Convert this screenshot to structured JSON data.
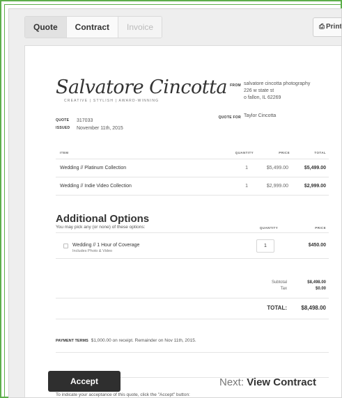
{
  "tabs": [
    {
      "label": "Quote",
      "state": "active"
    },
    {
      "label": "Contract",
      "state": "enabled"
    },
    {
      "label": "Invoice",
      "state": "disabled"
    }
  ],
  "print_label": "Print",
  "icons": {
    "print": "printer-icon",
    "checkbox": "checkbox-icon"
  },
  "logo": {
    "name": "Salvatore Cincotta",
    "tagline": "CREATIVE | STYLISH | AWARD-WINNING"
  },
  "from": {
    "label": "FROM",
    "lines": [
      "salvatore cincotta photography",
      "226 w state st",
      "o fallon, IL 62269"
    ]
  },
  "quote_for": {
    "label": "QUOTE FOR",
    "value": "Taylor Cincotta"
  },
  "meta": {
    "quote_label": "QUOTE",
    "quote_value": "317033",
    "issued_label": "ISSUED",
    "issued_value": "November 11th, 2015"
  },
  "items_header": {
    "item": "ITEM",
    "quantity": "QUANTITY",
    "price": "PRICE",
    "total": "TOTAL"
  },
  "items": [
    {
      "name": "Wedding // Platinum Collection",
      "quantity": "1",
      "price": "$5,499.00",
      "total": "$5,499.00"
    },
    {
      "name": "Wedding // Indie Video Collection",
      "quantity": "1",
      "price": "$2,999.00",
      "total": "$2,999.00"
    }
  ],
  "additional": {
    "title": "Additional Options",
    "subtitle": "You may pick any (or none) of these options:",
    "quantity_header": "QUANTITY",
    "price_header": "PRICE",
    "options": [
      {
        "name": "Wedding // 1 Hour of Coverage",
        "desc": "Includes Photo & Video",
        "quantity": "1",
        "price": "$450.00",
        "checked": false
      }
    ]
  },
  "summary": {
    "subtotal_label": "Subtotal",
    "subtotal_value": "$8,498.00",
    "tax_label": "Tax",
    "tax_value": "$0.00",
    "total_label": "TOTAL:",
    "total_value": "$8,498.00"
  },
  "payment_terms": {
    "label": "PAYMENT TERMS",
    "text": "$1,000.00 on receipt. Remainder on Nov 11th, 2015."
  },
  "acceptance_note": "To indicate your acceptance of this quote, click the \"Accept\" button:",
  "accept_label": "Accept",
  "next": {
    "prefix": "Next:",
    "label": "View Contract"
  },
  "colors": {
    "frame_green": "#5cae4a",
    "accept_bg": "#2f2f2f",
    "page_bg": "#eeeeee"
  }
}
